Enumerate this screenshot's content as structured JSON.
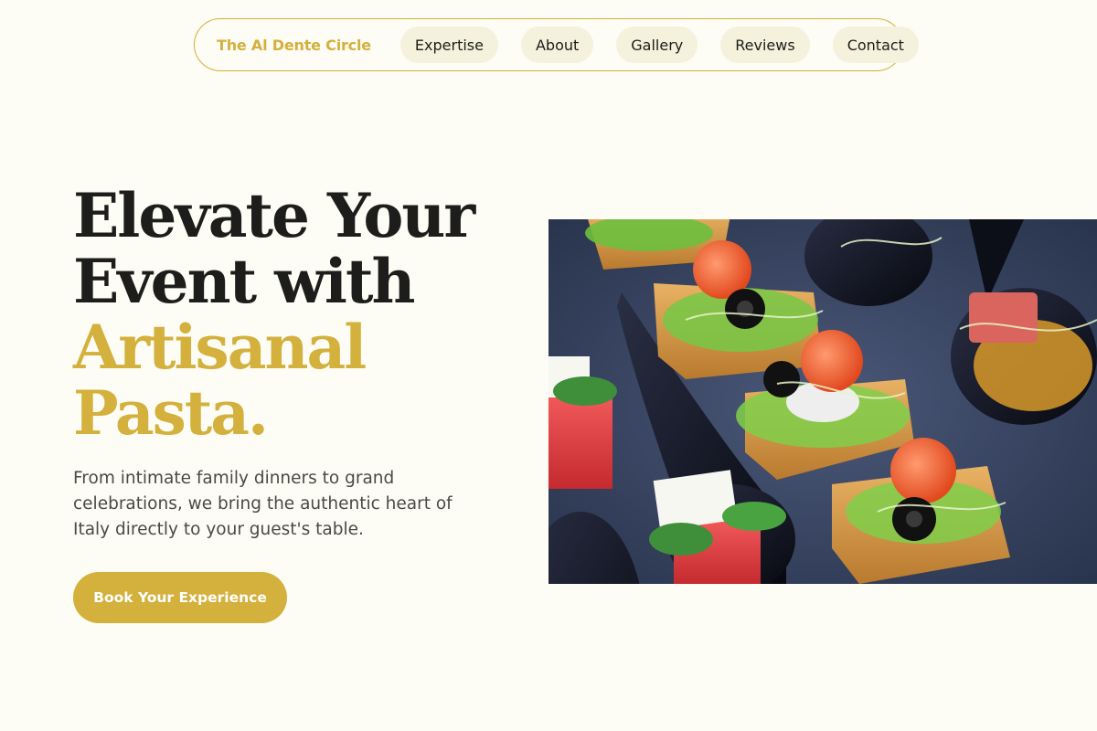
{
  "nav": {
    "brand": "The Al Dente Circle",
    "links": [
      {
        "label": "Expertise"
      },
      {
        "label": "About"
      },
      {
        "label": "Gallery"
      },
      {
        "label": "Reviews"
      },
      {
        "label": "Contact"
      }
    ]
  },
  "hero": {
    "title_lines": [
      {
        "text": "Elevate Your"
      },
      {
        "text": "Event with"
      },
      {
        "text": "Artisanal"
      },
      {
        "text": "Pasta."
      }
    ],
    "subtitle": "From intimate family dinners to grand celebrations, we bring the authentic heart of Italy directly to your guest's table.",
    "cta_label": "Book Your Experience"
  },
  "image": {
    "subject": "appetizer-canapes-photo"
  },
  "colors": {
    "accent": "#d4b03c",
    "background": "#fdfcf5",
    "text": "#1d1d1b",
    "nav_pill": "#f4f2dc"
  }
}
